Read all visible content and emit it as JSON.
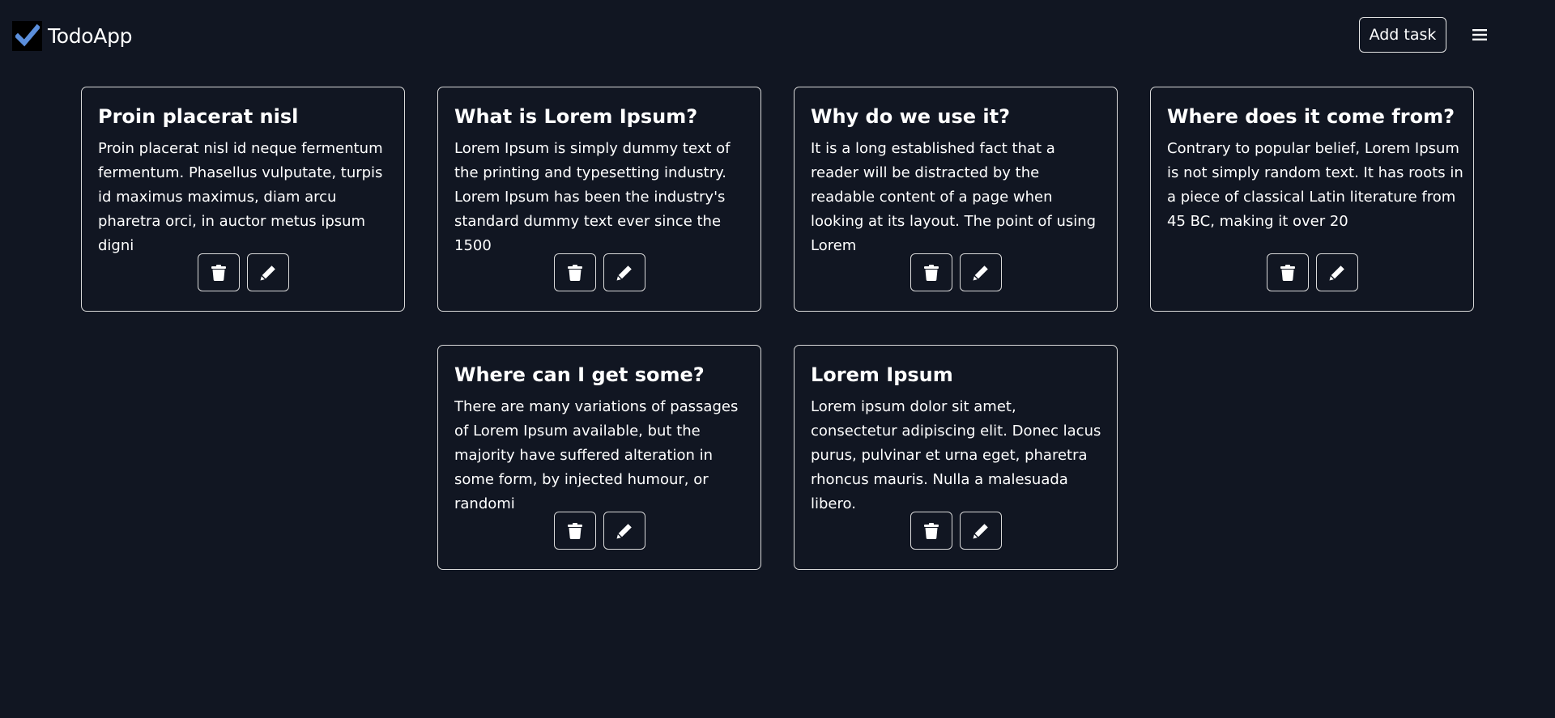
{
  "navbar": {
    "brand": "TodoApp",
    "add_task_label": "Add task",
    "logo_icon": "checkmark-icon",
    "menu_icon": "hamburger-menu-icon"
  },
  "colors": {
    "background": "#111622",
    "border": "#d9d9d9",
    "text": "#ffffff",
    "logo_check": "#4a86d9"
  },
  "cards": [
    {
      "title": "Proin placerat nisl",
      "text": "Proin placerat nisl id neque fermentum fermentum. Phasellus vulputate, turpis id maximus maximus, diam arcu pharetra orci, in auctor metus ipsum digni",
      "delete_icon": "trash-icon",
      "edit_icon": "pencil-icon"
    },
    {
      "title": "What is Lorem Ipsum?",
      "text": "Lorem Ipsum is simply dummy text of the printing and typesetting industry. Lorem Ipsum has been the industry's standard dummy text ever since the 1500",
      "delete_icon": "trash-icon",
      "edit_icon": "pencil-icon"
    },
    {
      "title": "Why do we use it?",
      "text": "It is a long established fact that a reader will be distracted by the readable content of a page when looking at its layout. The point of using Lorem",
      "delete_icon": "trash-icon",
      "edit_icon": "pencil-icon"
    },
    {
      "title": "Where does it come from?",
      "text": "Contrary to popular belief, Lorem Ipsum is not simply random text. It has roots in a piece of classical Latin literature from 45 BC, making it over 20",
      "delete_icon": "trash-icon",
      "edit_icon": "pencil-icon"
    },
    {
      "title": "Where can I get some?",
      "text": "There are many variations of passages of Lorem Ipsum available, but the majority have suffered alteration in some form, by injected humour, or randomi",
      "delete_icon": "trash-icon",
      "edit_icon": "pencil-icon"
    },
    {
      "title": "Lorem Ipsum",
      "text": "Lorem ipsum dolor sit amet, consectetur adipiscing elit. Donec lacus purus, pulvinar et urna eget, pharetra rhoncus mauris. Nulla a malesuada libero.",
      "delete_icon": "trash-icon",
      "edit_icon": "pencil-icon"
    }
  ]
}
